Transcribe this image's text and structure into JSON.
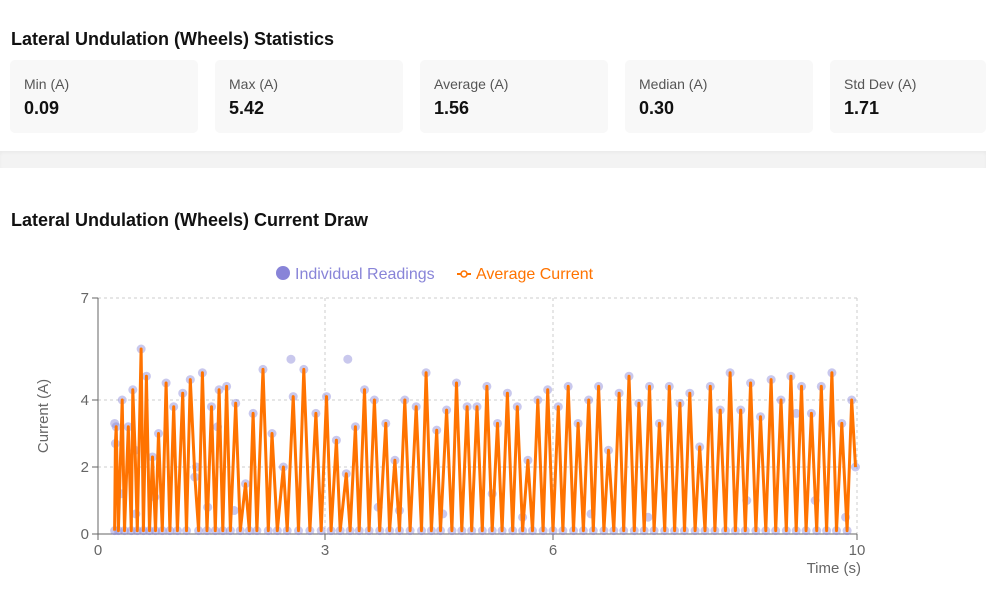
{
  "stats_section": {
    "title": "Lateral Undulation (Wheels) Statistics",
    "cards": [
      {
        "label": "Min (A)",
        "value": "0.09"
      },
      {
        "label": "Max (A)",
        "value": "5.42"
      },
      {
        "label": "Average (A)",
        "value": "1.56"
      },
      {
        "label": "Median (A)",
        "value": "0.30"
      },
      {
        "label": "Std Dev (A)",
        "value": "1.71"
      }
    ]
  },
  "chart_section": {
    "title": "Lateral Undulation (Wheels) Current Draw"
  },
  "chart_data": {
    "type": "line",
    "xlabel": "Time (s)",
    "ylabel": "Current (A)",
    "xlim": [
      0,
      10
    ],
    "ylim": [
      0,
      7
    ],
    "x_ticks": [
      0,
      3,
      6,
      10
    ],
    "y_ticks": [
      0,
      2,
      4,
      7
    ],
    "grid": true,
    "legend_position": "top-center",
    "series": [
      {
        "name": "Individual Readings",
        "kind": "scatter",
        "color": "#8884d8"
      },
      {
        "name": "Average Current",
        "kind": "line",
        "color": "#ff7300"
      }
    ],
    "points": [
      [
        0.22,
        0.1
      ],
      [
        0.23,
        2.7
      ],
      [
        0.24,
        3.2
      ],
      [
        0.27,
        0.1
      ],
      [
        0.32,
        4.0
      ],
      [
        0.35,
        0.1
      ],
      [
        0.4,
        3.2
      ],
      [
        0.44,
        0.1
      ],
      [
        0.46,
        4.3
      ],
      [
        0.49,
        2.5
      ],
      [
        0.52,
        0.1
      ],
      [
        0.57,
        5.5
      ],
      [
        0.6,
        0.1
      ],
      [
        0.64,
        4.7
      ],
      [
        0.68,
        0.1
      ],
      [
        0.72,
        2.3
      ],
      [
        0.76,
        0.1
      ],
      [
        0.8,
        3.0
      ],
      [
        0.85,
        0.1
      ],
      [
        0.9,
        4.5
      ],
      [
        0.95,
        0.1
      ],
      [
        1.0,
        3.8
      ],
      [
        1.05,
        0.1
      ],
      [
        1.12,
        4.2
      ],
      [
        1.17,
        0.1
      ],
      [
        1.22,
        4.6
      ],
      [
        1.28,
        1.7
      ],
      [
        1.33,
        0.1
      ],
      [
        1.38,
        4.8
      ],
      [
        1.44,
        0.1
      ],
      [
        1.5,
        3.8
      ],
      [
        1.55,
        0.1
      ],
      [
        1.6,
        4.3
      ],
      [
        1.65,
        0.1
      ],
      [
        1.7,
        4.4
      ],
      [
        1.75,
        0.1
      ],
      [
        1.82,
        3.9
      ],
      [
        1.88,
        0.1
      ],
      [
        1.95,
        1.5
      ],
      [
        2.0,
        0.1
      ],
      [
        2.05,
        3.6
      ],
      [
        2.1,
        0.1
      ],
      [
        2.18,
        4.9
      ],
      [
        2.25,
        0.1
      ],
      [
        2.3,
        3.0
      ],
      [
        2.37,
        0.1
      ],
      [
        2.45,
        2.0
      ],
      [
        2.5,
        0.1
      ],
      [
        2.58,
        4.1
      ],
      [
        2.65,
        0.1
      ],
      [
        2.72,
        4.9
      ],
      [
        2.8,
        0.1
      ],
      [
        2.88,
        3.6
      ],
      [
        2.95,
        0.1
      ],
      [
        3.02,
        4.1
      ],
      [
        3.08,
        0.1
      ],
      [
        3.15,
        2.8
      ],
      [
        3.2,
        0.1
      ],
      [
        3.28,
        1.8
      ],
      [
        3.33,
        0.1
      ],
      [
        3.4,
        3.2
      ],
      [
        3.45,
        0.1
      ],
      [
        3.52,
        4.3
      ],
      [
        3.58,
        0.1
      ],
      [
        3.65,
        4.0
      ],
      [
        3.72,
        0.1
      ],
      [
        3.8,
        3.3
      ],
      [
        3.85,
        0.1
      ],
      [
        3.92,
        2.2
      ],
      [
        3.98,
        0.1
      ],
      [
        4.05,
        4.0
      ],
      [
        4.12,
        0.1
      ],
      [
        4.2,
        3.8
      ],
      [
        4.27,
        0.1
      ],
      [
        4.33,
        4.8
      ],
      [
        4.4,
        0.1
      ],
      [
        4.47,
        3.1
      ],
      [
        4.52,
        0.1
      ],
      [
        4.6,
        3.7
      ],
      [
        4.67,
        0.1
      ],
      [
        4.73,
        4.5
      ],
      [
        4.8,
        0.1
      ],
      [
        4.87,
        3.8
      ],
      [
        4.93,
        0.1
      ],
      [
        5.0,
        3.8
      ],
      [
        5.07,
        0.1
      ],
      [
        5.13,
        4.4
      ],
      [
        5.2,
        0.1
      ],
      [
        5.27,
        3.3
      ],
      [
        5.33,
        0.1
      ],
      [
        5.4,
        4.2
      ],
      [
        5.47,
        0.1
      ],
      [
        5.53,
        3.8
      ],
      [
        5.6,
        0.1
      ],
      [
        5.67,
        2.2
      ],
      [
        5.73,
        0.1
      ],
      [
        5.8,
        4.0
      ],
      [
        5.87,
        0.1
      ],
      [
        5.93,
        4.3
      ],
      [
        6.0,
        0.1
      ],
      [
        6.07,
        3.8
      ],
      [
        6.13,
        0.1
      ],
      [
        6.2,
        4.4
      ],
      [
        6.27,
        0.1
      ],
      [
        6.33,
        3.3
      ],
      [
        6.4,
        0.1
      ],
      [
        6.47,
        4.0
      ],
      [
        6.53,
        0.1
      ],
      [
        6.6,
        4.4
      ],
      [
        6.67,
        0.1
      ],
      [
        6.73,
        2.5
      ],
      [
        6.8,
        0.1
      ],
      [
        6.87,
        4.2
      ],
      [
        6.93,
        0.1
      ],
      [
        7.0,
        4.7
      ],
      [
        7.07,
        0.1
      ],
      [
        7.13,
        3.9
      ],
      [
        7.2,
        0.1
      ],
      [
        7.27,
        4.4
      ],
      [
        7.33,
        0.1
      ],
      [
        7.4,
        3.3
      ],
      [
        7.47,
        0.1
      ],
      [
        7.53,
        4.4
      ],
      [
        7.6,
        0.1
      ],
      [
        7.67,
        3.9
      ],
      [
        7.73,
        0.1
      ],
      [
        7.8,
        4.2
      ],
      [
        7.87,
        0.1
      ],
      [
        7.93,
        2.6
      ],
      [
        8.0,
        0.1
      ],
      [
        8.07,
        4.4
      ],
      [
        8.13,
        0.1
      ],
      [
        8.2,
        3.7
      ],
      [
        8.27,
        0.1
      ],
      [
        8.33,
        4.8
      ],
      [
        8.4,
        0.1
      ],
      [
        8.47,
        3.7
      ],
      [
        8.53,
        0.1
      ],
      [
        8.6,
        4.5
      ],
      [
        8.67,
        0.1
      ],
      [
        8.73,
        3.5
      ],
      [
        8.8,
        0.1
      ],
      [
        8.87,
        4.6
      ],
      [
        8.93,
        0.1
      ],
      [
        9.0,
        4.0
      ],
      [
        9.07,
        0.1
      ],
      [
        9.13,
        4.7
      ],
      [
        9.2,
        0.1
      ],
      [
        9.27,
        4.4
      ],
      [
        9.33,
        0.1
      ],
      [
        9.4,
        3.6
      ],
      [
        9.47,
        0.1
      ],
      [
        9.53,
        4.4
      ],
      [
        9.6,
        0.1
      ],
      [
        9.67,
        4.8
      ],
      [
        9.73,
        0.1
      ],
      [
        9.8,
        3.3
      ],
      [
        9.87,
        0.1
      ],
      [
        9.93,
        4.0
      ],
      [
        9.98,
        2.0
      ]
    ],
    "extra_readings": [
      [
        0.22,
        3.3
      ],
      [
        0.3,
        1.2
      ],
      [
        0.5,
        0.6
      ],
      [
        0.75,
        1.1
      ],
      [
        1.3,
        2.0
      ],
      [
        1.45,
        0.8
      ],
      [
        1.58,
        3.2
      ],
      [
        1.8,
        0.7
      ],
      [
        2.55,
        5.2
      ],
      [
        3.3,
        5.2
      ],
      [
        3.7,
        0.8
      ],
      [
        3.98,
        0.7
      ],
      [
        4.55,
        0.6
      ],
      [
        5.2,
        1.2
      ],
      [
        5.6,
        0.5
      ],
      [
        6.5,
        0.6
      ],
      [
        7.25,
        0.5
      ],
      [
        8.55,
        1.0
      ],
      [
        9.2,
        3.6
      ],
      [
        9.45,
        1.0
      ],
      [
        9.85,
        0.5
      ]
    ]
  }
}
